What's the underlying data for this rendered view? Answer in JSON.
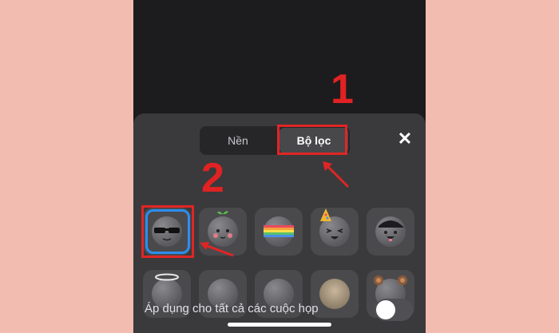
{
  "tabs": [
    {
      "label": "Nền",
      "active": false
    },
    {
      "label": "Bộ lọc",
      "active": true
    }
  ],
  "close_icon": "close-icon",
  "annotations": {
    "step1": "1",
    "step2": "2"
  },
  "filters": [
    {
      "name": "sunglasses-filter-icon",
      "selected": true
    },
    {
      "name": "sprout-filter-icon",
      "selected": false
    },
    {
      "name": "rainbow-filter-icon",
      "selected": false
    },
    {
      "name": "party-hat-filter-icon",
      "selected": false
    },
    {
      "name": "cap-filter-icon",
      "selected": false
    },
    {
      "name": "halo-filter-icon",
      "selected": false
    },
    {
      "name": "plain-face-filter-icon",
      "selected": false
    },
    {
      "name": "plain-face-filter-icon",
      "selected": false
    },
    {
      "name": "cat-ears-filter-icon",
      "selected": false
    },
    {
      "name": "bear-ears-filter-icon",
      "selected": false
    }
  ],
  "apply_all_label": "Áp dụng cho tất cả các cuộc họp",
  "apply_all_on": false,
  "colors": {
    "highlight": "#e02525",
    "selected": "#2d8ef0"
  }
}
